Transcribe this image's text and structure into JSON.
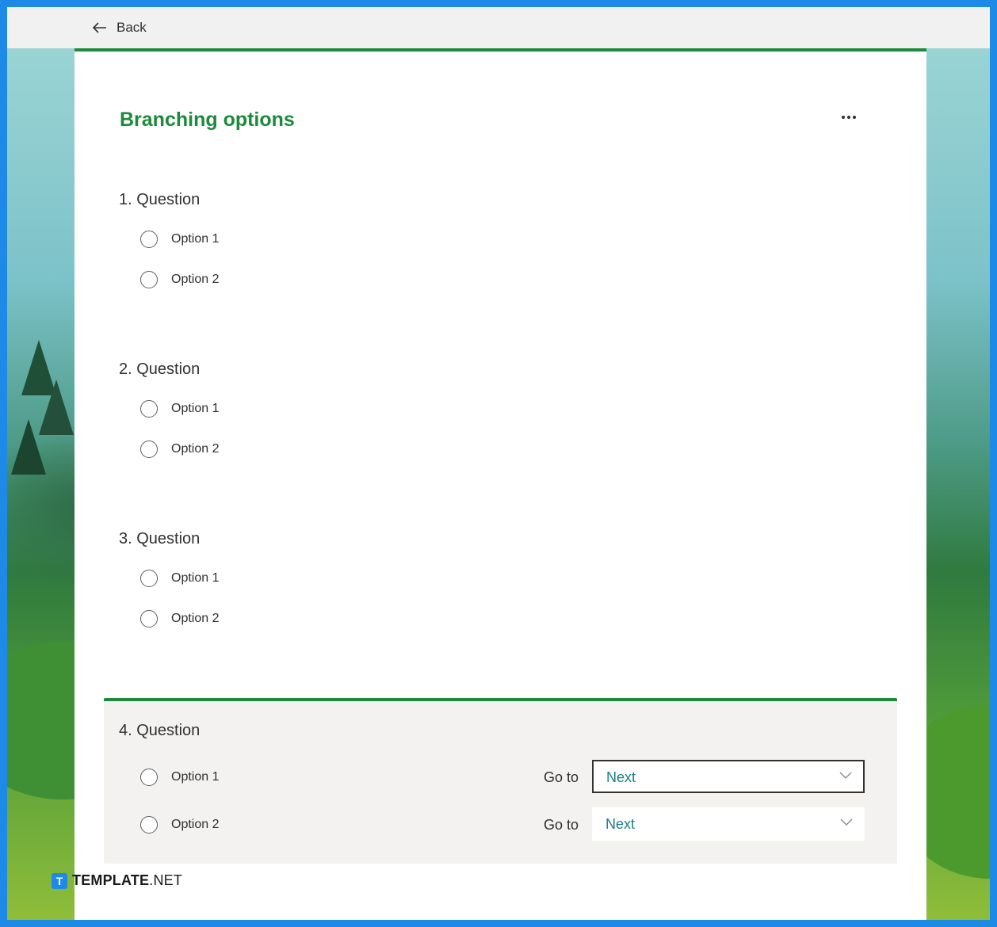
{
  "nav": {
    "back_label": "Back"
  },
  "form": {
    "title": "Branching options"
  },
  "questions": [
    {
      "title": "1. Question",
      "options": [
        "Option 1",
        "Option 2"
      ]
    },
    {
      "title": "2. Question",
      "options": [
        "Option 1",
        "Option 2"
      ]
    },
    {
      "title": "3. Question",
      "options": [
        "Option 1",
        "Option 2"
      ]
    }
  ],
  "branching_question": {
    "title": "4. Question",
    "rows": [
      {
        "option": "Option 1",
        "goto_label": "Go to",
        "goto_value": "Next"
      },
      {
        "option": "Option 2",
        "goto_label": "Go to",
        "goto_value": "Next"
      }
    ]
  },
  "watermark": {
    "brand": "TEMPLATE",
    "suffix": ".NET",
    "logo_letter": "T"
  },
  "colors": {
    "accent": "#1b8a3a",
    "frame": "#1e8ae8",
    "select_text": "#1a7f86",
    "panel_bg": "#f3f2f1"
  }
}
